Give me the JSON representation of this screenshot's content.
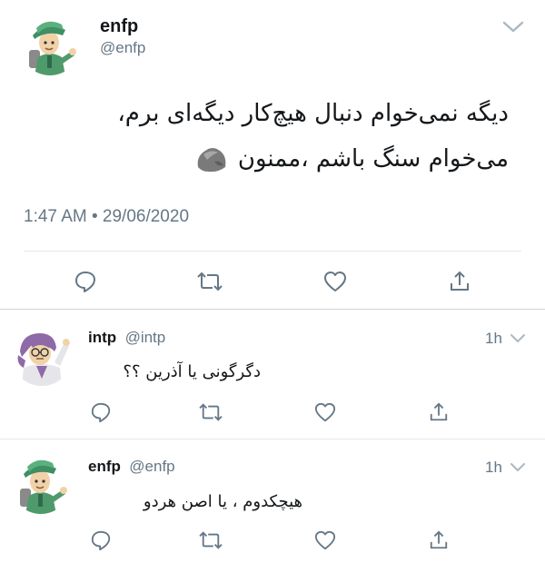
{
  "main_tweet": {
    "author_name": "enfp",
    "author_handle": "@enfp",
    "text_line1": "دیگه نمی‌خوام دنبال هیچ‌کار دیگه‌ای برم،",
    "text_line2": "می‌خوام سنگ باشم ،ممنون",
    "emoji": "rock",
    "timestamp": "1:47 AM • 29/06/2020"
  },
  "replies": [
    {
      "author_name": "intp",
      "author_handle": "@intp",
      "time": "1h",
      "text": "دگرگونی یا آذرین ؟؟"
    },
    {
      "author_name": "enfp",
      "author_handle": "@enfp",
      "time": "1h",
      "text": "هیچکدوم ، یا اصن هردو"
    }
  ],
  "icons": {
    "reply": "reply-icon",
    "retweet": "retweet-icon",
    "like": "heart-icon",
    "share": "share-icon",
    "caret": "chevron-down-icon"
  },
  "colors": {
    "text": "#14171a",
    "secondary": "#657786",
    "divider": "#e1e8ed",
    "enfp_green": "#3f8f63",
    "intp_purple": "#8e6aa8"
  }
}
